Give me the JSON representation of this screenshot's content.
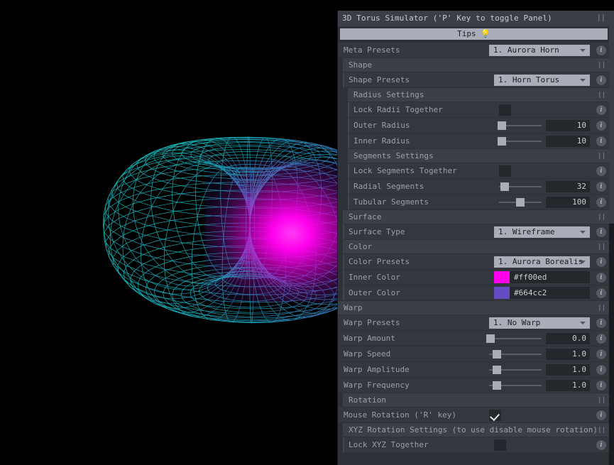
{
  "panel": {
    "title": "3D Torus Simulator ('P' Key to toggle Panel)",
    "grip_icon": "||",
    "tips_label": "Tips",
    "tips_bulb": "💡"
  },
  "rows": {
    "meta_presets": {
      "label": "Meta Presets",
      "value": "1. Aurora Horn"
    },
    "shape_section": "Shape",
    "shape_presets": {
      "label": "Shape Presets",
      "value": "1. Horn Torus"
    },
    "radius_section": "Radius Settings",
    "lock_radii": {
      "label": "Lock Radii Together",
      "checked": false
    },
    "outer_radius": {
      "label": "Outer Radius",
      "value": "10",
      "pct": 6
    },
    "inner_radius": {
      "label": "Inner Radius",
      "value": "10",
      "pct": 6
    },
    "segments_section": "Segments Settings",
    "lock_segments": {
      "label": "Lock Segments Together",
      "checked": false
    },
    "radial_segments": {
      "label": "Radial Segments",
      "value": "32",
      "pct": 13
    },
    "tubular_segments": {
      "label": "Tubular Segments",
      "value": "100",
      "pct": 50
    },
    "surface_section": "Surface",
    "surface_type": {
      "label": "Surface Type",
      "value": "1. Wireframe"
    },
    "color_section": "Color",
    "color_presets": {
      "label": "Color Presets",
      "value": "1. Aurora Borealis"
    },
    "inner_color": {
      "label": "Inner Color",
      "value": "#ff00ed"
    },
    "outer_color": {
      "label": "Outer Color",
      "value": "#664cc2"
    },
    "warp_section": "Warp",
    "warp_presets": {
      "label": "Warp Presets",
      "value": "1. No Warp"
    },
    "warp_amount": {
      "label": "Warp Amount",
      "value": "0.0",
      "pct": 3
    },
    "warp_speed": {
      "label": "Warp Speed",
      "value": "1.0",
      "pct": 15
    },
    "warp_amplitude": {
      "label": "Warp Amplitude",
      "value": "1.0",
      "pct": 15
    },
    "warp_frequency": {
      "label": "Warp Frequency",
      "value": "1.0",
      "pct": 15
    },
    "rotation_section": "Rotation",
    "mouse_rotation": {
      "label": "Mouse Rotation ('R' key)",
      "checked": true
    },
    "xyz_section": "XYZ Rotation Settings (to use disable mouse rotation)",
    "lock_xyz": {
      "label": "Lock XYZ Together",
      "checked": false
    }
  },
  "info_icon": "i",
  "colors": {
    "inner": "#ff00ed",
    "outer": "#664cc2",
    "wire_outer": "#17c4c4",
    "wire_inner": "#ff00ed",
    "panel_bg": "#2e3137",
    "row_bg": "#33373e",
    "section_bg": "#3b3f47",
    "dropdown_bg": "#a8adb7",
    "background": "#000000"
  },
  "viewport": {
    "object": "horn-torus-wireframe",
    "radial_segments": 32,
    "tubular_segments": 100
  }
}
